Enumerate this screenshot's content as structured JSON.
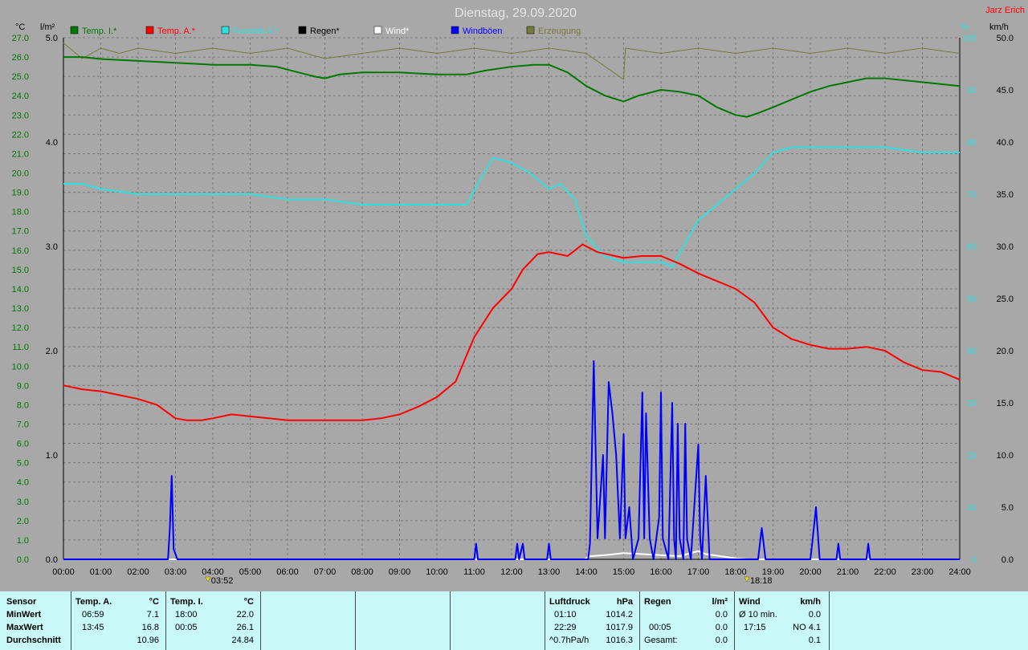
{
  "title": "Dienstag, 29.09.2020",
  "author": "Jarz Erich",
  "colors": {
    "bg": "#a8a8a8",
    "grid": "#7a7a7a",
    "temp_i": "#007800",
    "temp_a": "#ff0000",
    "feuchte": "#30e0e0",
    "wind": "#ffffff",
    "boeen": "#0000ff",
    "erzeugung": "#78783c"
  },
  "axes": {
    "left_unit": "°C",
    "rain_unit": "l/m²",
    "right_hum_unit": "%",
    "right_wind_unit": "km/h",
    "temp_ticks": [
      "0.0",
      "1.0",
      "2.0",
      "3.0",
      "4.0",
      "5.0",
      "6.0",
      "7.0",
      "8.0",
      "9.0",
      "10.0",
      "11.0",
      "12.0",
      "13.0",
      "14.0",
      "15.0",
      "16.0",
      "17.0",
      "18.0",
      "19.0",
      "20.0",
      "21.0",
      "22.0",
      "23.0",
      "24.0",
      "25.0",
      "26.0",
      "27.0"
    ],
    "rain_ticks": [
      "0.0",
      "1.0",
      "2.0",
      "3.0",
      "4.0",
      "5.0"
    ],
    "hum_ticks": [
      "0",
      "10",
      "20",
      "30",
      "40",
      "50",
      "60",
      "70",
      "80",
      "90",
      "100"
    ],
    "wind_ticks": [
      "0.0",
      "5.0",
      "10.0",
      "15.0",
      "20.0",
      "25.0",
      "30.0",
      "35.0",
      "40.0",
      "45.0",
      "50.0"
    ],
    "time_ticks": [
      "00:00",
      "01:00",
      "02:00",
      "03:00",
      "04:00",
      "05:00",
      "06:00",
      "07:00",
      "08:00",
      "09:00",
      "10:00",
      "11:00",
      "12:00",
      "13:00",
      "14:00",
      "15:00",
      "16:00",
      "17:00",
      "18:00",
      "19:00",
      "20:00",
      "21:00",
      "22:00",
      "23:00",
      "24:00"
    ]
  },
  "legend": [
    {
      "label": "Temp. I.*",
      "color": "#007800"
    },
    {
      "label": "Temp. A.*",
      "color": "#ff0000"
    },
    {
      "label": "Feuchte A.*",
      "color": "#30e0e0"
    },
    {
      "label": "Regen*",
      "color": "#000000"
    },
    {
      "label": "Wind*",
      "color": "#ffffff"
    },
    {
      "label": "Windböen",
      "color": "#0000ff"
    },
    {
      "label": "Erzeugung",
      "color": "#78783c"
    }
  ],
  "sun": {
    "sunrise": "03:52",
    "sunset": "18:18"
  },
  "chart_data": {
    "type": "line",
    "title": "Dienstag, 29.09.2020",
    "x_unit": "hour",
    "xlim": [
      0,
      24
    ],
    "temp_ylim": [
      0,
      27
    ],
    "rain_ylim": [
      0,
      5
    ],
    "hum_ylim": [
      0,
      100
    ],
    "wind_ylim": [
      0,
      50
    ],
    "series": [
      {
        "name": "Temp. I.*",
        "axis": "temp",
        "points": [
          [
            0,
            26.0
          ],
          [
            0.5,
            26.0
          ],
          [
            1,
            25.9
          ],
          [
            2,
            25.8
          ],
          [
            3,
            25.7
          ],
          [
            4,
            25.6
          ],
          [
            5,
            25.6
          ],
          [
            5.7,
            25.5
          ],
          [
            6.3,
            25.2
          ],
          [
            6.7,
            25.0
          ],
          [
            7,
            24.9
          ],
          [
            7.4,
            25.1
          ],
          [
            8,
            25.2
          ],
          [
            9,
            25.2
          ],
          [
            10,
            25.1
          ],
          [
            10.8,
            25.1
          ],
          [
            11.3,
            25.3
          ],
          [
            12,
            25.5
          ],
          [
            12.6,
            25.6
          ],
          [
            13,
            25.6
          ],
          [
            13.5,
            25.2
          ],
          [
            14,
            24.5
          ],
          [
            14.5,
            24.0
          ],
          [
            15,
            23.7
          ],
          [
            15.4,
            24.0
          ],
          [
            16,
            24.3
          ],
          [
            16.5,
            24.2
          ],
          [
            17,
            24.0
          ],
          [
            17.5,
            23.4
          ],
          [
            18,
            23.0
          ],
          [
            18.3,
            22.9
          ],
          [
            18.6,
            23.1
          ],
          [
            19,
            23.4
          ],
          [
            19.5,
            23.8
          ],
          [
            20,
            24.2
          ],
          [
            20.5,
            24.5
          ],
          [
            21,
            24.7
          ],
          [
            21.5,
            24.9
          ],
          [
            22,
            24.9
          ],
          [
            22.5,
            24.8
          ],
          [
            23,
            24.7
          ],
          [
            24,
            24.5
          ]
        ]
      },
      {
        "name": "Temp. A.*",
        "axis": "temp",
        "points": [
          [
            0,
            9.0
          ],
          [
            0.5,
            8.8
          ],
          [
            1,
            8.7
          ],
          [
            1.5,
            8.5
          ],
          [
            2,
            8.3
          ],
          [
            2.5,
            8.0
          ],
          [
            3,
            7.3
          ],
          [
            3.3,
            7.2
          ],
          [
            3.7,
            7.2
          ],
          [
            4,
            7.3
          ],
          [
            4.5,
            7.5
          ],
          [
            5,
            7.4
          ],
          [
            5.5,
            7.3
          ],
          [
            6,
            7.2
          ],
          [
            6.5,
            7.2
          ],
          [
            7,
            7.2
          ],
          [
            7.5,
            7.2
          ],
          [
            8,
            7.2
          ],
          [
            8.5,
            7.3
          ],
          [
            9,
            7.5
          ],
          [
            9.5,
            7.9
          ],
          [
            10,
            8.4
          ],
          [
            10.5,
            9.2
          ],
          [
            11,
            11.5
          ],
          [
            11.5,
            13.0
          ],
          [
            12,
            14.0
          ],
          [
            12.3,
            15.0
          ],
          [
            12.7,
            15.8
          ],
          [
            13,
            15.9
          ],
          [
            13.5,
            15.7
          ],
          [
            13.9,
            16.3
          ],
          [
            14.3,
            15.9
          ],
          [
            15,
            15.6
          ],
          [
            15.5,
            15.7
          ],
          [
            16,
            15.7
          ],
          [
            16.5,
            15.3
          ],
          [
            17,
            14.8
          ],
          [
            17.5,
            14.4
          ],
          [
            18,
            14.0
          ],
          [
            18.5,
            13.3
          ],
          [
            19,
            12.0
          ],
          [
            19.5,
            11.4
          ],
          [
            20,
            11.1
          ],
          [
            20.5,
            10.9
          ],
          [
            21,
            10.9
          ],
          [
            21.5,
            11.0
          ],
          [
            22,
            10.8
          ],
          [
            22.5,
            10.2
          ],
          [
            23,
            9.8
          ],
          [
            23.5,
            9.7
          ],
          [
            24,
            9.3
          ]
        ]
      },
      {
        "name": "Feuchte A.*",
        "axis": "hum",
        "points": [
          [
            0,
            72
          ],
          [
            0.5,
            72
          ],
          [
            1,
            71
          ],
          [
            2,
            70
          ],
          [
            3,
            70
          ],
          [
            4,
            70
          ],
          [
            5,
            70
          ],
          [
            6,
            69
          ],
          [
            7,
            69
          ],
          [
            8,
            68
          ],
          [
            9,
            68
          ],
          [
            10,
            68
          ],
          [
            10.8,
            68
          ],
          [
            11.1,
            72
          ],
          [
            11.5,
            77
          ],
          [
            12,
            76
          ],
          [
            12.5,
            74
          ],
          [
            13,
            71
          ],
          [
            13.3,
            72
          ],
          [
            13.7,
            69
          ],
          [
            14,
            62
          ],
          [
            14.5,
            58
          ],
          [
            15,
            57
          ],
          [
            15.5,
            57
          ],
          [
            16,
            57
          ],
          [
            16.3,
            56
          ],
          [
            16.6,
            60
          ],
          [
            17,
            65
          ],
          [
            17.5,
            68
          ],
          [
            18,
            71
          ],
          [
            18.5,
            74
          ],
          [
            19,
            78
          ],
          [
            19.5,
            79
          ],
          [
            20,
            79
          ],
          [
            21,
            79
          ],
          [
            22,
            79
          ],
          [
            23,
            78
          ],
          [
            24,
            78
          ]
        ]
      },
      {
        "name": "Windböen",
        "axis": "wind",
        "points": [
          [
            0,
            0
          ],
          [
            2.8,
            0
          ],
          [
            2.85,
            3
          ],
          [
            2.9,
            8
          ],
          [
            2.95,
            1
          ],
          [
            3.05,
            0
          ],
          [
            11,
            0
          ],
          [
            11.05,
            1.5
          ],
          [
            11.1,
            0
          ],
          [
            12.1,
            0
          ],
          [
            12.15,
            1.5
          ],
          [
            12.2,
            0
          ],
          [
            12.3,
            1.5
          ],
          [
            12.35,
            0
          ],
          [
            12.95,
            0
          ],
          [
            13,
            1.5
          ],
          [
            13.05,
            0
          ],
          [
            14.05,
            0
          ],
          [
            14.1,
            1.5
          ],
          [
            14.2,
            19
          ],
          [
            14.3,
            2
          ],
          [
            14.45,
            10
          ],
          [
            14.5,
            2
          ],
          [
            14.6,
            17
          ],
          [
            14.7,
            14
          ],
          [
            14.8,
            10
          ],
          [
            14.9,
            2
          ],
          [
            15,
            12
          ],
          [
            15.05,
            2
          ],
          [
            15.15,
            5
          ],
          [
            15.25,
            0
          ],
          [
            15.4,
            2
          ],
          [
            15.5,
            16
          ],
          [
            15.55,
            2
          ],
          [
            15.6,
            14
          ],
          [
            15.7,
            2
          ],
          [
            15.8,
            0
          ],
          [
            15.95,
            4
          ],
          [
            16,
            16
          ],
          [
            16.05,
            2
          ],
          [
            16.2,
            0
          ],
          [
            16.3,
            15
          ],
          [
            16.35,
            2
          ],
          [
            16.4,
            0
          ],
          [
            16.45,
            13
          ],
          [
            16.5,
            2
          ],
          [
            16.6,
            0
          ],
          [
            16.65,
            13
          ],
          [
            16.7,
            2
          ],
          [
            16.8,
            0
          ],
          [
            17,
            11
          ],
          [
            17.05,
            2
          ],
          [
            17.1,
            0
          ],
          [
            17.2,
            8
          ],
          [
            17.3,
            0
          ],
          [
            18.6,
            0
          ],
          [
            18.7,
            3
          ],
          [
            18.8,
            0
          ],
          [
            20.0,
            0
          ],
          [
            20.05,
            1.5
          ],
          [
            20.15,
            5
          ],
          [
            20.25,
            0
          ],
          [
            20.7,
            0
          ],
          [
            20.75,
            1.5
          ],
          [
            20.8,
            0
          ],
          [
            21.5,
            0
          ],
          [
            21.55,
            1.5
          ],
          [
            21.6,
            0
          ],
          [
            24,
            0
          ]
        ]
      },
      {
        "name": "Wind*",
        "axis": "wind",
        "points": [
          [
            0,
            0
          ],
          [
            13.95,
            0
          ],
          [
            14.1,
            0.3
          ],
          [
            14.5,
            0.4
          ],
          [
            15,
            0.6
          ],
          [
            15.5,
            0.5
          ],
          [
            16,
            0.4
          ],
          [
            16.5,
            0.3
          ],
          [
            17,
            0.8
          ],
          [
            17.2,
            0.5
          ],
          [
            17.6,
            0.3
          ],
          [
            18,
            0.1
          ],
          [
            18.3,
            0
          ],
          [
            24,
            0
          ]
        ]
      },
      {
        "name": "Regen*",
        "axis": "rain",
        "points": [
          [
            0,
            0
          ],
          [
            24,
            0
          ]
        ]
      },
      {
        "name": "Erzeugung",
        "axis": "hum",
        "points": [
          [
            0,
            99
          ],
          [
            0.5,
            96
          ],
          [
            1,
            98
          ],
          [
            1.5,
            97
          ],
          [
            2,
            98
          ],
          [
            3,
            97
          ],
          [
            4,
            98
          ],
          [
            5,
            97
          ],
          [
            6,
            98
          ],
          [
            7,
            96
          ],
          [
            8,
            97
          ],
          [
            9,
            98
          ],
          [
            10,
            97
          ],
          [
            11,
            98
          ],
          [
            12,
            97
          ],
          [
            13,
            98
          ],
          [
            14,
            97
          ],
          [
            15,
            92
          ],
          [
            15.05,
            98
          ],
          [
            16,
            97
          ],
          [
            17,
            98
          ],
          [
            18,
            97
          ],
          [
            19,
            98
          ],
          [
            20,
            97
          ],
          [
            21,
            98
          ],
          [
            22,
            97
          ],
          [
            23,
            98
          ],
          [
            24,
            97
          ]
        ]
      }
    ]
  },
  "stats": {
    "sensor_header": "Sensor",
    "min_label": "MinWert",
    "max_label": "MaxWert",
    "avg_label": "Durchschnitt",
    "ta_header": "Temp. A.",
    "ta_unit": "°C",
    "ta_min_time": "06:59",
    "ta_min": "7.1",
    "ta_max_time": "13:45",
    "ta_max": "16.8",
    "ta_avg": "10.96",
    "ti_header": "Temp. I.",
    "ti_unit": "°C",
    "ti_min_time": "18:00",
    "ti_min": "22.0",
    "ti_max_time": "00:05",
    "ti_max": "26.1",
    "ti_avg": "24.84",
    "lp_header": "Luftdruck",
    "lp_unit": "hPa",
    "lp_min_time": "01:10",
    "lp_min": "1014.2",
    "lp_max_time": "22:29",
    "lp_max": "1017.9",
    "lp_avg_label": "^0.7hPa/h",
    "lp_avg": "1016.3",
    "rg_header": "Regen",
    "rg_unit": "l/m²",
    "rg_min": "0.0",
    "rg_max_time": "00:05",
    "rg_max": "0.0",
    "rg_total_label": "Gesamt:",
    "rg_total": "0.0",
    "wd_header": "Wind",
    "wd_unit": "km/h",
    "wd_min_label": "Ø 10 min.",
    "wd_min": "0.0",
    "wd_max_time": "17:15",
    "wd_max": "NO 4.1",
    "wd_avg": "0.1"
  }
}
